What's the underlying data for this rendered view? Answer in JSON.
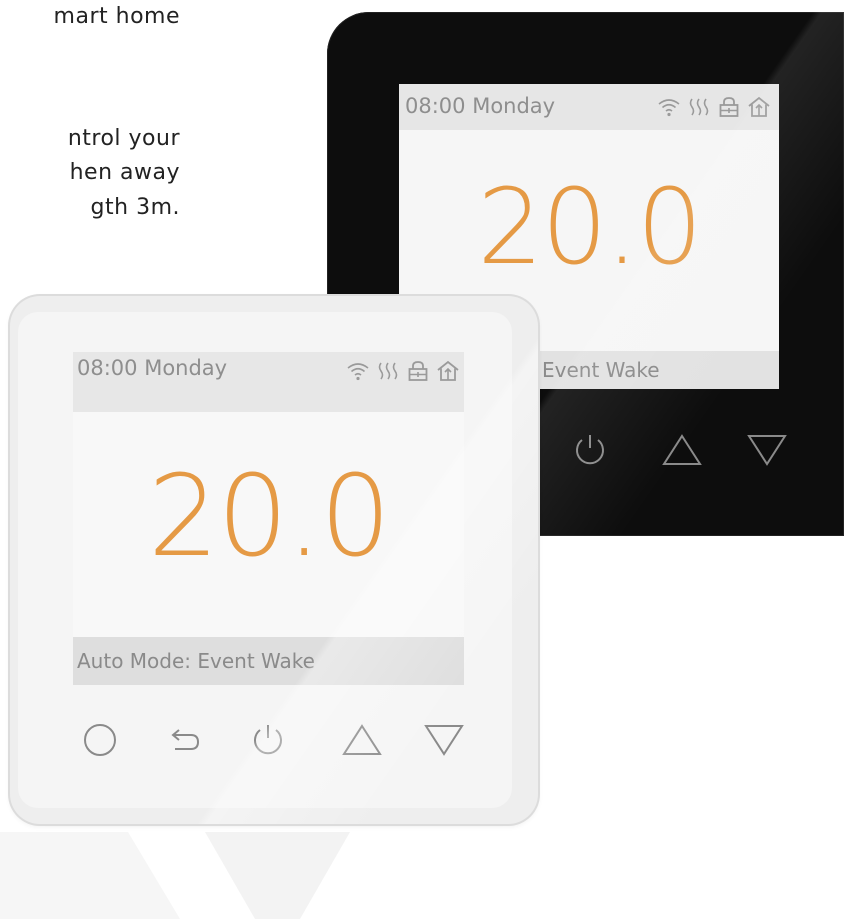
{
  "copy": {
    "lines": [
      "mart  home",
      "ntrol  your",
      "hen  away",
      "gth 3m."
    ]
  },
  "black_thermostat": {
    "time": "08:00 Monday",
    "temperature": "20.0",
    "status": "Event Wake",
    "status_icons": [
      "wifi-icon",
      "heating-icon",
      "lock-icon",
      "home-icon"
    ],
    "buttons": [
      "power-icon",
      "up-arrow-icon",
      "down-arrow-icon"
    ]
  },
  "white_thermostat": {
    "time": "08:00 Monday",
    "temperature": "20.0",
    "status": "Auto Mode: Event Wake",
    "status_icons": [
      "wifi-icon",
      "heating-icon",
      "lock-icon",
      "home-icon"
    ],
    "buttons": [
      "menu-circle-icon",
      "back-icon",
      "power-icon",
      "up-arrow-icon",
      "down-arrow-icon"
    ]
  },
  "colors": {
    "temperature": "#e59a45",
    "black_body": "#0d0d0d",
    "white_body": "#eeeeee",
    "screen_text": "#8e8e8e"
  }
}
